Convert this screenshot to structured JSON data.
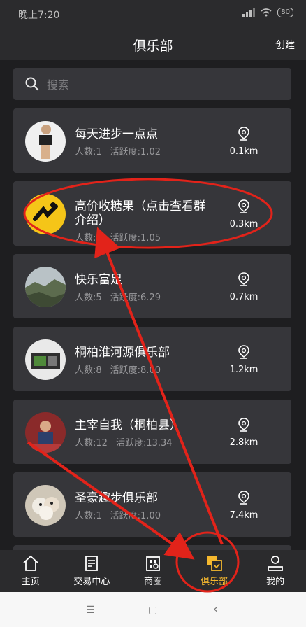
{
  "status": {
    "time": "晚上7:20",
    "battery": "80"
  },
  "header": {
    "title": "俱乐部",
    "create": "创建"
  },
  "search": {
    "placeholder": "搜索"
  },
  "clubs": [
    {
      "name": "每天进步一点点",
      "members": "人数:1",
      "activity": "活跃度:1.02",
      "distance": "0.1km"
    },
    {
      "name": "高价收糖果（点击查看群介绍）",
      "members": "人数:1",
      "activity": "活跃度:1.05",
      "distance": "0.3km"
    },
    {
      "name": "快乐富足",
      "members": "人数:5",
      "activity": "活跃度:6.29",
      "distance": "0.7km"
    },
    {
      "name": "桐柏淮河源俱乐部",
      "members": "人数:8",
      "activity": "活跃度:8.00",
      "distance": "1.2km"
    },
    {
      "name": "主宰自我（桐柏县）",
      "members": "人数:12",
      "activity": "活跃度:13.34",
      "distance": "2.8km"
    },
    {
      "name": "圣豪趣步俱乐部",
      "members": "人数:1",
      "activity": "活跃度:1.00",
      "distance": "7.4km"
    }
  ],
  "tabs": [
    {
      "label": "主页",
      "icon": "home-icon"
    },
    {
      "label": "交易中心",
      "icon": "document-icon"
    },
    {
      "label": "商圈",
      "icon": "store-icon"
    },
    {
      "label": "俱乐部",
      "icon": "club-icon"
    },
    {
      "label": "我的",
      "icon": "profile-icon"
    }
  ],
  "navbar": {
    "menu": "☰",
    "home": "▢",
    "back": "‹"
  },
  "colors": {
    "accent": "#f5b82e",
    "annotation": "#e2231a"
  }
}
